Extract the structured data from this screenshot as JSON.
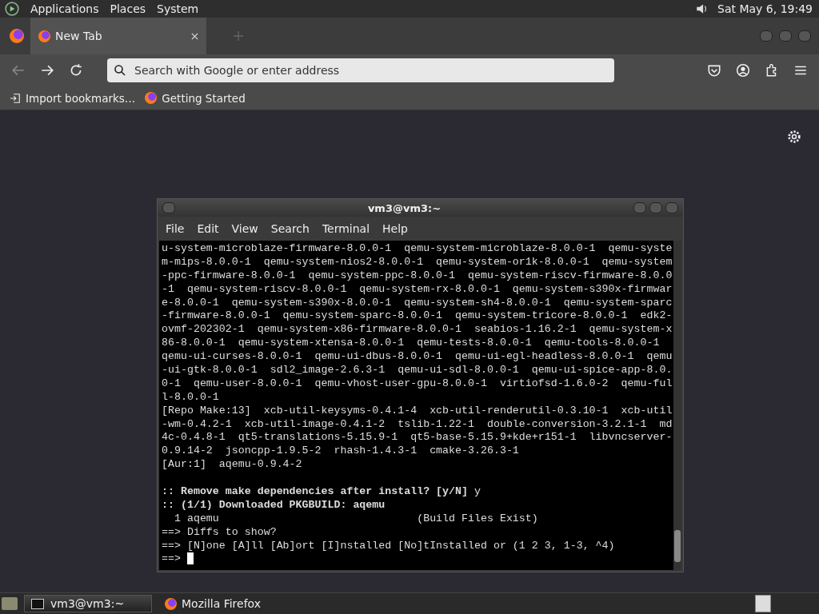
{
  "top_panel": {
    "menus": [
      "Applications",
      "Places",
      "System"
    ],
    "clock": "Sat May  6, 19:49"
  },
  "browser": {
    "tabs": [
      {
        "label": "New Tab",
        "selected": true
      }
    ],
    "address": {
      "placeholder": "Search with Google or enter address"
    },
    "bookmarks": [
      {
        "label": "Import bookmarks…",
        "kind": "import"
      },
      {
        "label": "Getting Started",
        "kind": "firefox"
      }
    ]
  },
  "terminal": {
    "title": "vm3@vm3:~",
    "menu": [
      "File",
      "Edit",
      "View",
      "Search",
      "Terminal",
      "Help"
    ],
    "lines": [
      {
        "kind": "text",
        "text": "u-system-microblaze-firmware-8.0.0-1  qemu-system-microblaze-8.0.0-1  qemu-syste"
      },
      {
        "kind": "text",
        "text": "m-mips-8.0.0-1  qemu-system-nios2-8.0.0-1  qemu-system-or1k-8.0.0-1  qemu-system"
      },
      {
        "kind": "text",
        "text": "-ppc-firmware-8.0.0-1  qemu-system-ppc-8.0.0-1  qemu-system-riscv-firmware-8.0.0"
      },
      {
        "kind": "text",
        "text": "-1  qemu-system-riscv-8.0.0-1  qemu-system-rx-8.0.0-1  qemu-system-s390x-firmwar"
      },
      {
        "kind": "text",
        "text": "e-8.0.0-1  qemu-system-s390x-8.0.0-1  qemu-system-sh4-8.0.0-1  qemu-system-sparc"
      },
      {
        "kind": "text",
        "text": "-firmware-8.0.0-1  qemu-system-sparc-8.0.0-1  qemu-system-tricore-8.0.0-1  edk2-"
      },
      {
        "kind": "text",
        "text": "ovmf-202302-1  qemu-system-x86-firmware-8.0.0-1  seabios-1.16.2-1  qemu-system-x"
      },
      {
        "kind": "text",
        "text": "86-8.0.0-1  qemu-system-xtensa-8.0.0-1  qemu-tests-8.0.0-1  qemu-tools-8.0.0-1"
      },
      {
        "kind": "text",
        "text": "qemu-ui-curses-8.0.0-1  qemu-ui-dbus-8.0.0-1  qemu-ui-egl-headless-8.0.0-1  qemu"
      },
      {
        "kind": "text",
        "text": "-ui-gtk-8.0.0-1  sdl2_image-2.6.3-1  qemu-ui-sdl-8.0.0-1  qemu-ui-spice-app-8.0."
      },
      {
        "kind": "text",
        "text": "0-1  qemu-user-8.0.0-1  qemu-vhost-user-gpu-8.0.0-1  virtiofsd-1.6.0-2  qemu-ful"
      },
      {
        "kind": "text",
        "text": "l-8.0.0-1"
      },
      {
        "kind": "text",
        "text": "[Repo Make:13]  xcb-util-keysyms-0.4.1-4  xcb-util-renderutil-0.3.10-1  xcb-util"
      },
      {
        "kind": "text",
        "text": "-wm-0.4.2-1  xcb-util-image-0.4.1-2  tslib-1.22-1  double-conversion-3.2.1-1  md"
      },
      {
        "kind": "text",
        "text": "4c-0.4.8-1  qt5-translations-5.15.9-1  qt5-base-5.15.9+kde+r151-1  libvncserver-"
      },
      {
        "kind": "text",
        "text": "0.9.14-2  jsoncpp-1.9.5-2  rhash-1.4.3-1  cmake-3.26.3-1"
      },
      {
        "kind": "text",
        "text": "[Aur:1]  aqemu-0.9.4-2"
      },
      {
        "kind": "blank"
      },
      {
        "kind": "text",
        "text": "**:: Remove make dependencies after install? [y/N]** y"
      },
      {
        "kind": "text",
        "text": "**:: (1/1) Downloaded PKGBUILD: aqemu**"
      },
      {
        "kind": "text",
        "text": "  1 aqemu                               (Build Files Exist)"
      },
      {
        "kind": "text",
        "text": "==> Diffs to show?"
      },
      {
        "kind": "text",
        "text": "==> [N]one [A]ll [Ab]ort [I]nstalled [No]tInstalled or (1 2 3, 1-3, ^4)"
      },
      {
        "kind": "prompt",
        "text": "==> "
      }
    ]
  },
  "taskbar": {
    "tasks": [
      {
        "label": "vm3@vm3:~",
        "kind": "terminal",
        "selected": true
      },
      {
        "label": "Mozilla Firefox",
        "kind": "firefox",
        "selected": false
      }
    ]
  }
}
